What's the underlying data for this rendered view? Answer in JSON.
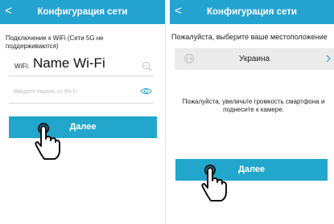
{
  "left_screen": {
    "header": {
      "back_glyph": "<",
      "title": "Конфигурация сети"
    },
    "hint": "Подключение к WiFi (Сети 5G не поддерживаются)",
    "wifi": {
      "label": "WiFi:",
      "ssid": "Name Wi-Fi",
      "icon": "search-icon"
    },
    "password": {
      "placeholder": "Введите пароль от Wi-Fi",
      "value": "",
      "icon": "eye-icon"
    },
    "next_button": "Далее"
  },
  "right_screen": {
    "header": {
      "back_glyph": "<",
      "title": "Конфигурация сети"
    },
    "location_prompt": "Пожалуйста, выберите ваше местоположение",
    "country": {
      "value": "Украина",
      "icon": "globe-icon",
      "chevron": "chevron-right-icon"
    },
    "volume_hint": "Пожалуйста, увеличьте громкость смартфона и поднесите к камере.",
    "next_button": "Далее"
  },
  "overlay": {
    "icon": "pointing-hand-icon"
  },
  "colors": {
    "accent": "#24a3d1",
    "button": "#22a6cc",
    "row_bg": "#ebebeb",
    "divider": "#d8d8d8"
  }
}
